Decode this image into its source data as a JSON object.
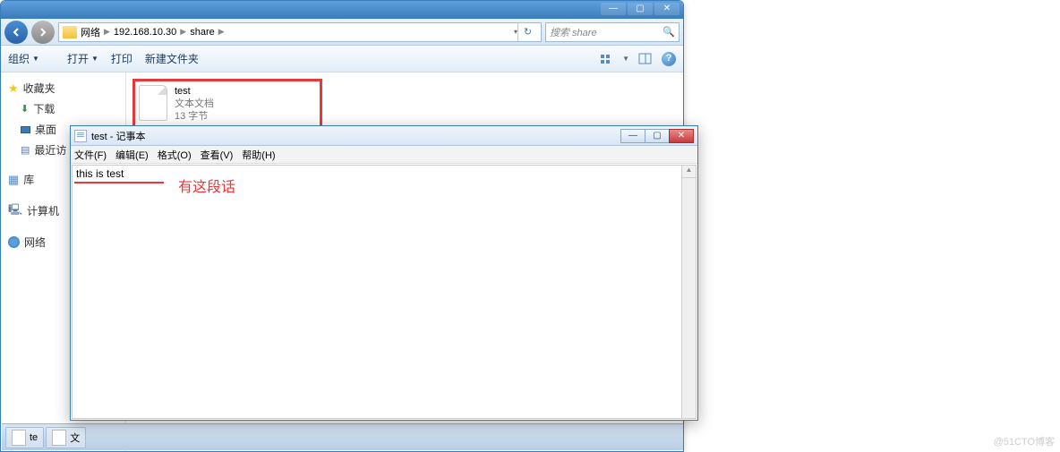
{
  "explorer": {
    "breadcrumb": {
      "root": "网络",
      "ip": "192.168.10.30",
      "folder": "share"
    },
    "addr_dropdown": "▾",
    "refresh_glyph": "↻",
    "search": {
      "placeholder": "搜索 share",
      "glyph": "🔍"
    },
    "toolbar": {
      "organize": "组织",
      "open": "打开",
      "print": "打印",
      "new_folder": "新建文件夹",
      "help_glyph": "?"
    },
    "sidebar": {
      "favorites": "收藏夹",
      "downloads": "下载",
      "desktop": "桌面",
      "recent": "最近访",
      "library": "库",
      "computer": "计算机",
      "network": "网络"
    },
    "file": {
      "name": "test",
      "type": "文本文档",
      "size": "13 字节"
    },
    "titlebar": {
      "min": "—",
      "max": "▢",
      "close": "✕"
    }
  },
  "notepad": {
    "title": "test - 记事本",
    "menu": {
      "file": "文件(F)",
      "edit": "编辑(E)",
      "format": "格式(O)",
      "view": "查看(V)",
      "help": "帮助(H)"
    },
    "content": "this is test",
    "ctrl": {
      "min": "—",
      "max": "▢",
      "close": "✕"
    }
  },
  "annotation": {
    "text": "有这段话"
  },
  "taskbar": {
    "item1": "te",
    "item2": "文"
  },
  "watermark": "@51CTO博客"
}
